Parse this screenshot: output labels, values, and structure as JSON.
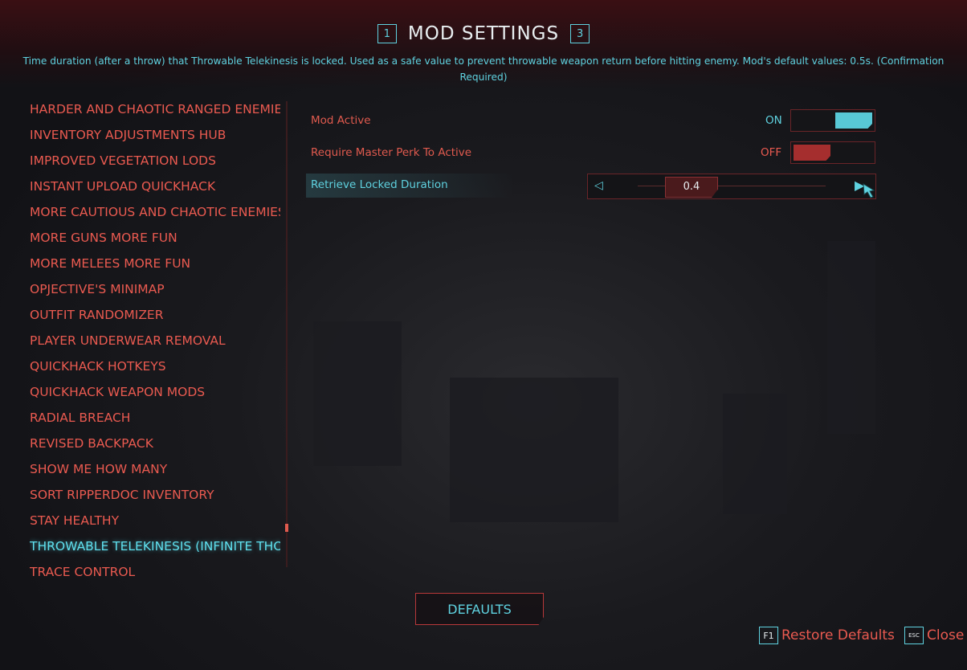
{
  "header": {
    "title": "MOD SETTINGS",
    "prev_key": "1",
    "next_key": "3"
  },
  "description": "Time duration (after a throw) that Throwable Telekinesis is locked. Used as a safe value to prevent throwable weapon return before hitting enemy. Mod's default values: 0.5s. (Confirmation Required)",
  "mods": [
    {
      "label": "HARDER AND CHAOTIC RANGED ENEMIES",
      "active": false
    },
    {
      "label": "INVENTORY ADJUSTMENTS HUB",
      "active": false
    },
    {
      "label": "IMPROVED VEGETATION LODS",
      "active": false
    },
    {
      "label": "INSTANT UPLOAD QUICKHACK",
      "active": false
    },
    {
      "label": "MORE CAUTIOUS AND CHAOTIC ENEMIES",
      "active": false
    },
    {
      "label": "MORE GUNS MORE FUN",
      "active": false
    },
    {
      "label": "MORE MELEES MORE FUN",
      "active": false
    },
    {
      "label": "OPJECTIVE'S MINIMAP",
      "active": false
    },
    {
      "label": "OUTFIT RANDOMIZER",
      "active": false
    },
    {
      "label": "PLAYER UNDERWEAR REMOVAL",
      "active": false
    },
    {
      "label": "QUICKHACK HOTKEYS",
      "active": false
    },
    {
      "label": "QUICKHACK WEAPON MODS",
      "active": false
    },
    {
      "label": "RADIAL BREACH",
      "active": false
    },
    {
      "label": "REVISED BACKPACK",
      "active": false
    },
    {
      "label": "SHOW ME HOW MANY",
      "active": false
    },
    {
      "label": "SORT RIPPERDOC INVENTORY",
      "active": false
    },
    {
      "label": "STAY HEALTHY",
      "active": false
    },
    {
      "label": "THROWABLE TELEKINESIS (INFINITE THOW",
      "active": true
    },
    {
      "label": "TRACE CONTROL",
      "active": false
    }
  ],
  "settings": {
    "mod_active": {
      "label": "Mod Active",
      "state": "ON"
    },
    "require_master_perk": {
      "label": "Require Master Perk To Active",
      "state": "OFF"
    },
    "retrieve_locked_duration": {
      "label": "Retrieve Locked Duration",
      "value": "0.4",
      "slider_fraction": 0.4
    }
  },
  "buttons": {
    "defaults": "DEFAULTS"
  },
  "footer": {
    "restore_key": "F1",
    "restore_label": "Restore Defaults",
    "close_key": "ESC",
    "close_label": "Close"
  },
  "colors": {
    "accent_cyan": "#5fd2e0",
    "accent_red": "#ea5a50",
    "toggle_on": "#58c8d6",
    "toggle_off": "#a52e2e"
  },
  "icons": {
    "slider_decrease": "triangle-left-icon",
    "slider_increase": "triangle-right-icon",
    "cursor": "hand-cursor-icon"
  }
}
